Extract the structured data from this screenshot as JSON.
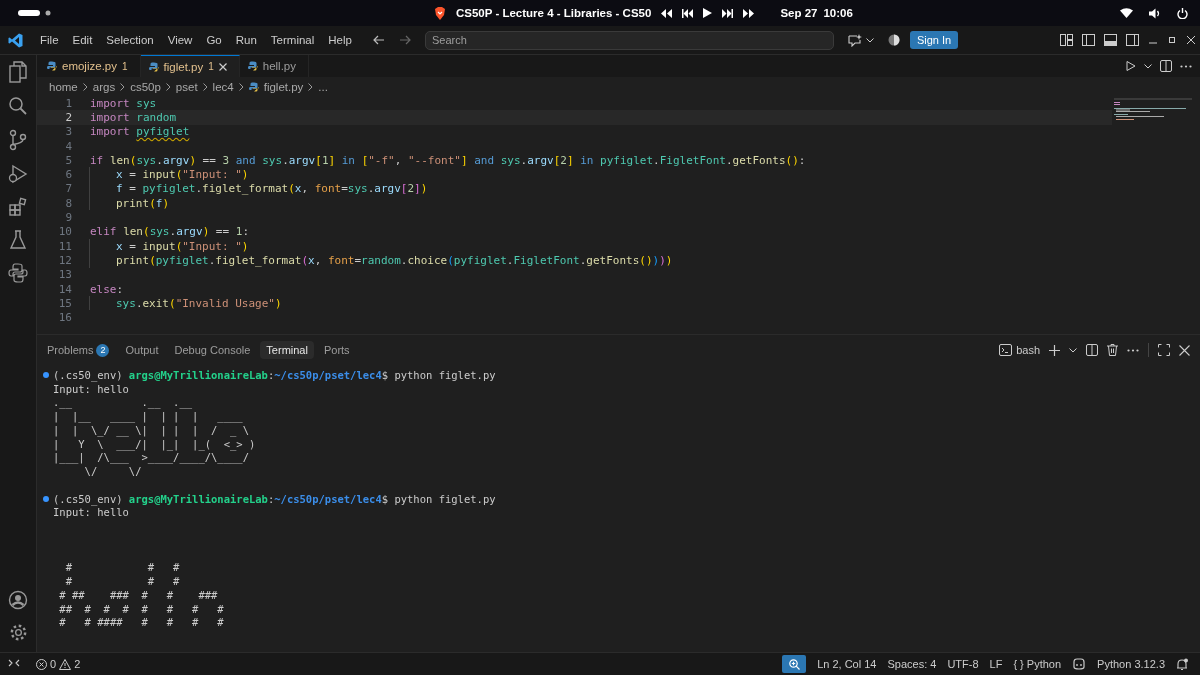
{
  "top_bar": {
    "window_title": "CS50P - Lecture 4 - Libraries - CS50",
    "date": "Sep 27",
    "time": "10:06"
  },
  "menu": [
    "File",
    "Edit",
    "Selection",
    "View",
    "Go",
    "Run",
    "Terminal",
    "Help"
  ],
  "search": {
    "placeholder": "Search"
  },
  "sign_in": "Sign In",
  "tabs": [
    {
      "label": "emojize.py",
      "badge": "1",
      "warning": true,
      "selected": false
    },
    {
      "label": "figlet.py",
      "badge": "1",
      "warning": true,
      "selected": true
    },
    {
      "label": "hell.py",
      "warning": false,
      "selected": false
    }
  ],
  "breadcrumb": [
    {
      "label": "home",
      "kind": "folder"
    },
    {
      "label": "args",
      "kind": "folder"
    },
    {
      "label": "cs50p",
      "kind": "folder"
    },
    {
      "label": "pset",
      "kind": "folder"
    },
    {
      "label": "lec4",
      "kind": "folder"
    },
    {
      "label": "figlet.py",
      "kind": "file"
    },
    {
      "label": "...",
      "kind": "more"
    }
  ],
  "editor": {
    "lines": [
      {
        "number": "1",
        "current": false,
        "indent": false,
        "tokens": [
          {
            "text": "import ",
            "kind": "kw"
          },
          {
            "text": "sys",
            "kind": "mod"
          }
        ]
      },
      {
        "number": "2",
        "current": true,
        "indent": false,
        "tokens": [
          {
            "text": "import ",
            "kind": "kw"
          },
          {
            "text": "random",
            "kind": "mod"
          }
        ]
      },
      {
        "number": "3",
        "current": false,
        "indent": false,
        "tokens": [
          {
            "text": "import ",
            "kind": "kw"
          },
          {
            "text": "pyfiglet",
            "kind": "warn"
          }
        ]
      },
      {
        "number": "4",
        "current": false,
        "indent": false
      },
      {
        "number": "5",
        "current": false,
        "indent": false,
        "tokens": [
          {
            "text": "if ",
            "kind": "kw"
          },
          {
            "text": "len",
            "kind": "fn"
          },
          {
            "text": "(",
            "kind": "b1"
          },
          {
            "text": "sys",
            "kind": "mod"
          },
          {
            "text": ".",
            "kind": "plain"
          },
          {
            "text": "argv",
            "kind": "var"
          },
          {
            "text": ")",
            "kind": "b1"
          },
          {
            "text": " == ",
            "kind": "plain"
          },
          {
            "text": "3 ",
            "kind": "num"
          },
          {
            "text": "and ",
            "kind": "op"
          },
          {
            "text": "sys",
            "kind": "mod"
          },
          {
            "text": ".",
            "kind": "plain"
          },
          {
            "text": "argv",
            "kind": "var"
          },
          {
            "text": "[",
            "kind": "b1"
          },
          {
            "text": "1",
            "kind": "num"
          },
          {
            "text": "] ",
            "kind": "b1"
          },
          {
            "text": "in ",
            "kind": "op"
          },
          {
            "text": "[",
            "kind": "b1"
          },
          {
            "text": "\"-f\"",
            "kind": "str"
          },
          {
            "text": ", ",
            "kind": "plain"
          },
          {
            "text": "\"--font\"",
            "kind": "str"
          },
          {
            "text": "] ",
            "kind": "b1"
          },
          {
            "text": "and ",
            "kind": "op"
          },
          {
            "text": "sys",
            "kind": "mod"
          },
          {
            "text": ".",
            "kind": "plain"
          },
          {
            "text": "argv",
            "kind": "var"
          },
          {
            "text": "[",
            "kind": "b1"
          },
          {
            "text": "2",
            "kind": "num"
          },
          {
            "text": "] ",
            "kind": "b1"
          },
          {
            "text": "in ",
            "kind": "op"
          },
          {
            "text": "pyfiglet",
            "kind": "mod"
          },
          {
            "text": ".",
            "kind": "plain"
          },
          {
            "text": "FigletFont",
            "kind": "cls"
          },
          {
            "text": ".",
            "kind": "plain"
          },
          {
            "text": "getFonts",
            "kind": "fn"
          },
          {
            "text": "()",
            "kind": "b1"
          },
          {
            "text": ":",
            "kind": "plain"
          }
        ]
      },
      {
        "number": "6",
        "current": false,
        "indent": true,
        "tokens": [
          {
            "text": "x",
            "kind": "var"
          },
          {
            "text": " = ",
            "kind": "plain"
          },
          {
            "text": "input",
            "kind": "fn"
          },
          {
            "text": "(",
            "kind": "b1"
          },
          {
            "text": "\"Input: \"",
            "kind": "str"
          },
          {
            "text": ")",
            "kind": "b1"
          }
        ]
      },
      {
        "number": "7",
        "current": false,
        "indent": true,
        "tokens": [
          {
            "text": "f",
            "kind": "var"
          },
          {
            "text": " = ",
            "kind": "plain"
          },
          {
            "text": "pyfiglet",
            "kind": "mod"
          },
          {
            "text": ".",
            "kind": "plain"
          },
          {
            "text": "figlet_format",
            "kind": "fn"
          },
          {
            "text": "(",
            "kind": "b1"
          },
          {
            "text": "x",
            "kind": "var"
          },
          {
            "text": ", ",
            "kind": "plain"
          },
          {
            "text": "font",
            "kind": "param"
          },
          {
            "text": "=",
            "kind": "plain"
          },
          {
            "text": "sys",
            "kind": "mod"
          },
          {
            "text": ".",
            "kind": "plain"
          },
          {
            "text": "argv",
            "kind": "var"
          },
          {
            "text": "[",
            "kind": "b2"
          },
          {
            "text": "2",
            "kind": "num"
          },
          {
            "text": "]",
            "kind": "b2"
          },
          {
            "text": ")",
            "kind": "b1"
          }
        ]
      },
      {
        "number": "8",
        "current": false,
        "indent": true,
        "tokens": [
          {
            "text": "print",
            "kind": "fn"
          },
          {
            "text": "(",
            "kind": "b1"
          },
          {
            "text": "f",
            "kind": "var"
          },
          {
            "text": ")",
            "kind": "b1"
          }
        ]
      },
      {
        "number": "9",
        "current": false,
        "indent": false
      },
      {
        "number": "10",
        "current": false,
        "indent": false,
        "tokens": [
          {
            "text": "elif ",
            "kind": "kw"
          },
          {
            "text": "len",
            "kind": "fn"
          },
          {
            "text": "(",
            "kind": "b1"
          },
          {
            "text": "sys",
            "kind": "mod"
          },
          {
            "text": ".",
            "kind": "plain"
          },
          {
            "text": "argv",
            "kind": "var"
          },
          {
            "text": ")",
            "kind": "b1"
          },
          {
            "text": " == ",
            "kind": "plain"
          },
          {
            "text": "1",
            "kind": "num"
          },
          {
            "text": ":",
            "kind": "plain"
          }
        ]
      },
      {
        "number": "11",
        "current": false,
        "indent": true,
        "tokens": [
          {
            "text": "x",
            "kind": "var"
          },
          {
            "text": " = ",
            "kind": "plain"
          },
          {
            "text": "input",
            "kind": "fn"
          },
          {
            "text": "(",
            "kind": "b1"
          },
          {
            "text": "\"Input: \"",
            "kind": "str"
          },
          {
            "text": ")",
            "kind": "b1"
          }
        ]
      },
      {
        "number": "12",
        "current": false,
        "indent": true,
        "tokens": [
          {
            "text": "print",
            "kind": "fn"
          },
          {
            "text": "(",
            "kind": "b1"
          },
          {
            "text": "pyfiglet",
            "kind": "mod"
          },
          {
            "text": ".",
            "kind": "plain"
          },
          {
            "text": "figlet_format",
            "kind": "fn"
          },
          {
            "text": "(",
            "kind": "b2"
          },
          {
            "text": "x",
            "kind": "var"
          },
          {
            "text": ", ",
            "kind": "plain"
          },
          {
            "text": "font",
            "kind": "param"
          },
          {
            "text": "=",
            "kind": "plain"
          },
          {
            "text": "random",
            "kind": "mod"
          },
          {
            "text": ".",
            "kind": "plain"
          },
          {
            "text": "choice",
            "kind": "fn"
          },
          {
            "text": "(",
            "kind": "b3"
          },
          {
            "text": "pyfiglet",
            "kind": "mod"
          },
          {
            "text": ".",
            "kind": "plain"
          },
          {
            "text": "FigletFont",
            "kind": "cls"
          },
          {
            "text": ".",
            "kind": "plain"
          },
          {
            "text": "getFonts",
            "kind": "fn"
          },
          {
            "text": "()",
            "kind": "b1"
          },
          {
            "text": ")",
            "kind": "b3"
          },
          {
            "text": ")",
            "kind": "b2"
          },
          {
            "text": ")",
            "kind": "b1"
          }
        ]
      },
      {
        "number": "13",
        "current": false,
        "indent": false
      },
      {
        "number": "14",
        "current": false,
        "indent": false,
        "tokens": [
          {
            "text": "else",
            "kind": "kw"
          },
          {
            "text": ":",
            "kind": "plain"
          }
        ]
      },
      {
        "number": "15",
        "current": false,
        "indent": true,
        "tokens": [
          {
            "text": "sys",
            "kind": "mod"
          },
          {
            "text": ".",
            "kind": "plain"
          },
          {
            "text": "exit",
            "kind": "fn"
          },
          {
            "text": "(",
            "kind": "b1"
          },
          {
            "text": "\"Invalid Usage\"",
            "kind": "str"
          },
          {
            "text": ")",
            "kind": "b1"
          }
        ]
      },
      {
        "number": "16",
        "current": false,
        "indent": false
      }
    ]
  },
  "panel": {
    "tabs": [
      {
        "label": "Problems",
        "badge": "2",
        "selected": false
      },
      {
        "label": "Output",
        "selected": false
      },
      {
        "label": "Debug Console",
        "selected": false
      },
      {
        "label": "Terminal",
        "selected": true
      },
      {
        "label": "Ports",
        "selected": false
      }
    ],
    "shell": "bash",
    "terminal": [
      {
        "kind": "prompt",
        "parts": [
          {
            "text": "(.cs50_env) ",
            "kind": "env"
          },
          {
            "text": "args@MyTrillionaireLab",
            "kind": "user"
          },
          {
            "text": ":",
            "kind": "plain"
          },
          {
            "text": "~/cs50p/pset/lec4",
            "kind": "path"
          },
          {
            "text": "$ python figlet.py",
            "kind": "plain"
          }
        ]
      },
      {
        "kind": "output",
        "text": "Input: hello"
      },
      {
        "kind": "output",
        "text": ".__           .__  .__"
      },
      {
        "kind": "output",
        "text": "|  |__   ____ |  | |  |   ____"
      },
      {
        "kind": "output",
        "text": "|  |  \\_/ __ \\|  | |  |  /  _ \\"
      },
      {
        "kind": "output",
        "text": "|   Y  \\  ___/|  |_|  |_(  <_> )"
      },
      {
        "kind": "output",
        "text": "|___|  /\\___  >____/____/\\____/"
      },
      {
        "kind": "output",
        "text": "     \\/     \\/"
      },
      {
        "kind": "blank"
      },
      {
        "kind": "prompt",
        "parts": [
          {
            "text": "(.cs50_env) ",
            "kind": "env"
          },
          {
            "text": "args@MyTrillionaireLab",
            "kind": "user"
          },
          {
            "text": ":",
            "kind": "plain"
          },
          {
            "text": "~/cs50p/pset/lec4",
            "kind": "path"
          },
          {
            "text": "$ python figlet.py",
            "kind": "plain"
          }
        ]
      },
      {
        "kind": "output",
        "text": "Input: hello"
      },
      {
        "kind": "blank"
      },
      {
        "kind": "blank"
      },
      {
        "kind": "blank"
      },
      {
        "kind": "output",
        "text": "  #            #   #"
      },
      {
        "kind": "output",
        "text": "  #            #   #"
      },
      {
        "kind": "output",
        "text": " # ##    ###  #   #    ###"
      },
      {
        "kind": "output",
        "text": " ##  #  #  #  #   #   #   #"
      },
      {
        "kind": "output",
        "text": " #   # ####   #   #   #   #"
      }
    ]
  },
  "status_bar": {
    "errors": "0",
    "warnings": "2",
    "right": [
      {
        "kind": "zoom"
      },
      {
        "kind": "text",
        "label": "Ln 2, Col 14"
      },
      {
        "kind": "text",
        "label": "Spaces: 4"
      },
      {
        "kind": "text",
        "label": "UTF-8"
      },
      {
        "kind": "text",
        "label": "LF"
      },
      {
        "kind": "text",
        "label": "{ } Python"
      },
      {
        "kind": "copilot"
      },
      {
        "kind": "text",
        "label": "Python 3.12.3"
      },
      {
        "kind": "bell"
      }
    ]
  }
}
